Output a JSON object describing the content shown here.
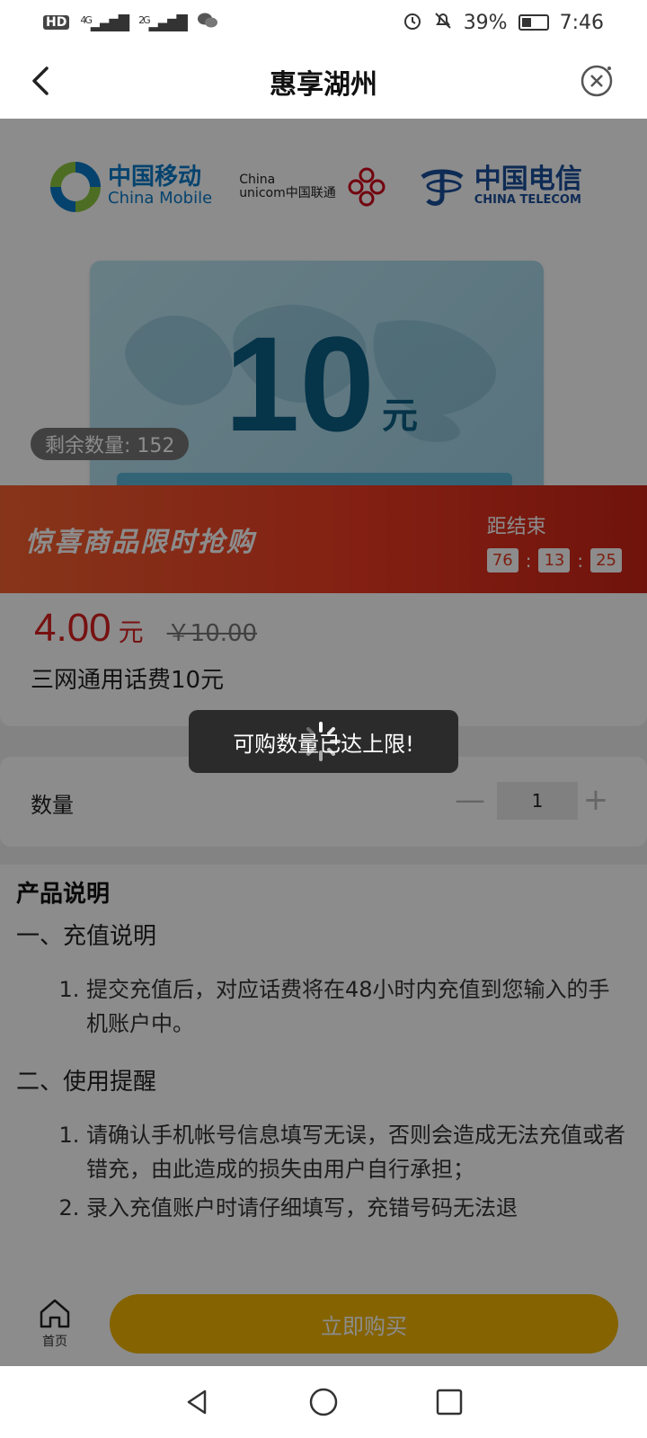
{
  "status_bar": {
    "hd": "HD",
    "net1": "4G",
    "net2": "2G",
    "battery": "39%",
    "battery_level": 0.39,
    "time": "7:46"
  },
  "nav": {
    "title": "惠享湖州"
  },
  "carriers": {
    "mobile_cn": "中国移动",
    "mobile_en": "China Mobile",
    "unicom_en1": "China",
    "unicom_en2": "unicom中国联通",
    "telecom_cn": "中国电信",
    "telecom_en": "CHINA TELECOM"
  },
  "card": {
    "amount": "10",
    "unit": "元"
  },
  "stock": {
    "label": "剩余数量: 152"
  },
  "flash": {
    "title": "惊喜商品限时抢购",
    "countdown_label": "距结束",
    "hours": "76",
    "minutes": "13",
    "seconds": "25",
    "sep": ":"
  },
  "product": {
    "price": "4.00",
    "price_unit": "元",
    "old_price": "￥10.00",
    "name": "三网通用话费10元"
  },
  "toast": {
    "message": "可购数量已达上限!"
  },
  "quantity": {
    "label": "数量",
    "value": "1",
    "minus": "—",
    "plus": "+"
  },
  "description": {
    "title": "产品说明",
    "section1": "一、充值说明",
    "section1_items": [
      "提交充值后，对应话费将在48小时内充值到您输入的手机账户中。"
    ],
    "section2": "二、使用提醒",
    "section2_items": [
      "请确认手机帐号信息填写无误，否则会造成无法充值或者错充，由此造成的损失由用户自行承担；",
      "录入充值账户时请仔细填写，充错号码无法退"
    ]
  },
  "bottom": {
    "home_label": "首页",
    "buy_label": "立即购买"
  },
  "colors": {
    "accent_red": "#d91f1f",
    "flash_orange": "#ef3b24",
    "buy_yellow": "#f1b500"
  }
}
